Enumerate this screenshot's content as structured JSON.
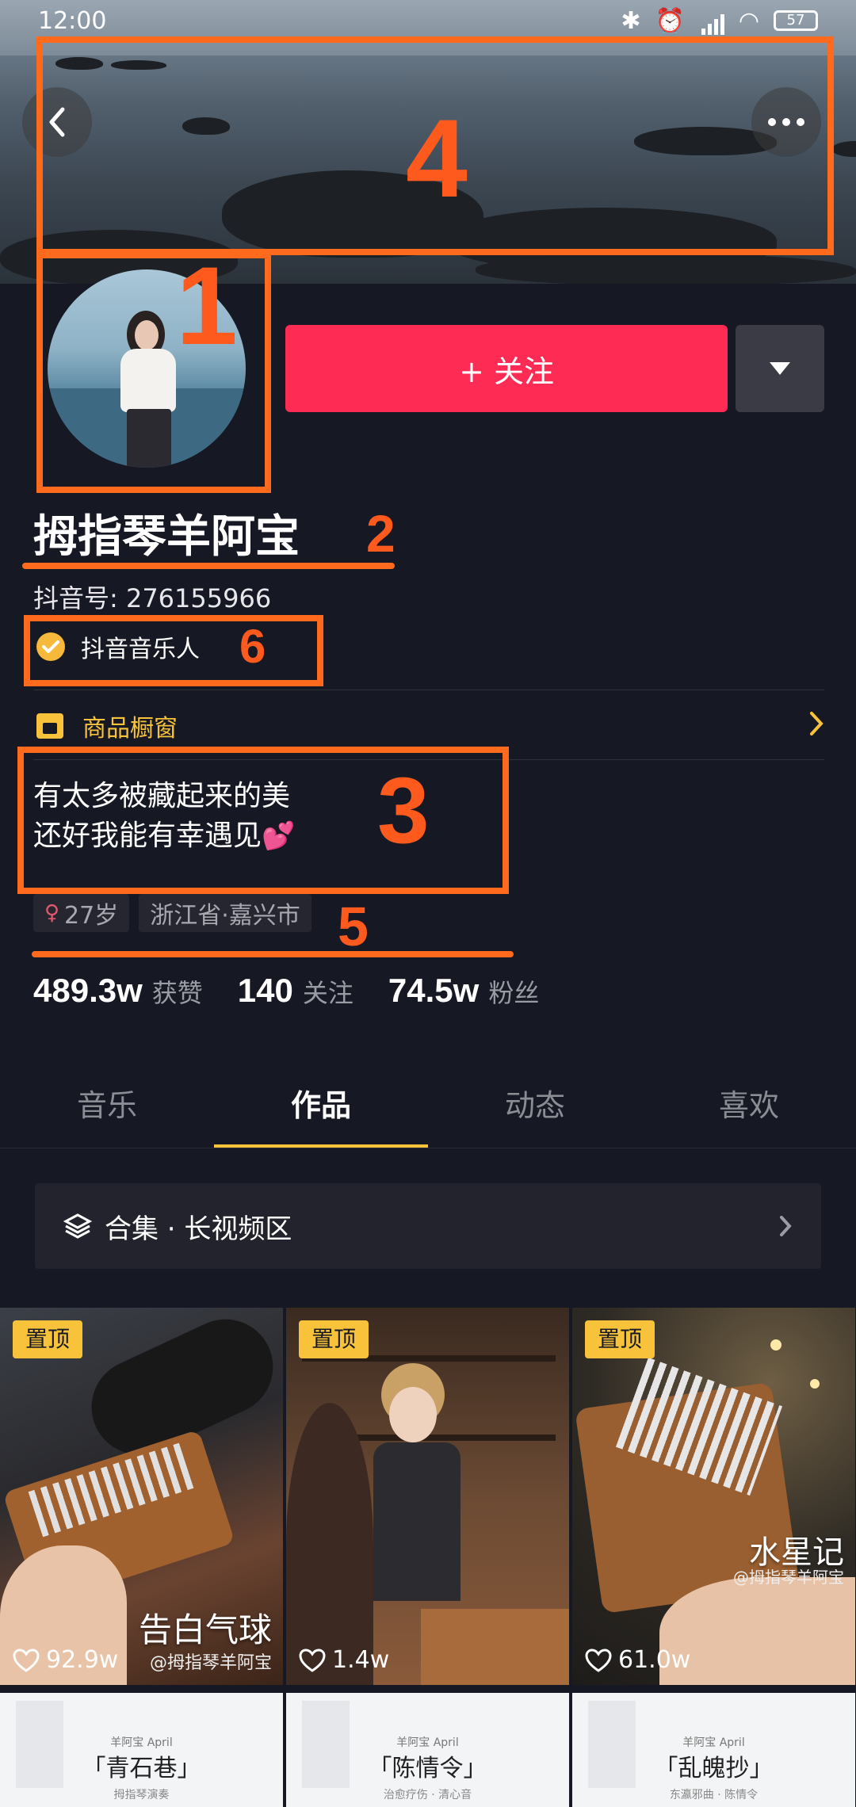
{
  "status_bar": {
    "time": "12:00",
    "battery": "57"
  },
  "header": {
    "back_icon": "back-arrow-icon",
    "more_icon": "more-dots-icon"
  },
  "profile": {
    "name": "拇指琴羊阿宝",
    "douyin_id": "抖音号: 276155966",
    "verification": "抖音音乐人",
    "follow_label": "+ 关注",
    "shop_label": "商品橱窗",
    "bio_line1": "有太多被藏起来的美",
    "bio_line2": "还好我能有幸遇见",
    "tags": [
      "27岁",
      "浙江省·嘉兴市"
    ],
    "stats": [
      {
        "value": "489.3w",
        "label": "获赞"
      },
      {
        "value": "140",
        "label": "关注"
      },
      {
        "value": "74.5w",
        "label": "粉丝"
      }
    ]
  },
  "tabs": [
    "音乐",
    "作品",
    "动态",
    "喜欢"
  ],
  "active_tab": "作品",
  "collection_label": "合集 · 长视频区",
  "videos": [
    {
      "pin": "置顶",
      "likes": "92.9w",
      "title": "告白气球",
      "handle": "@拇指琴羊阿宝"
    },
    {
      "pin": "置顶",
      "likes": "1.4w"
    },
    {
      "pin": "置顶",
      "likes": "61.0w",
      "title": "水星记",
      "handle": "@拇指琴羊阿宝"
    }
  ],
  "videos_row2": [
    {
      "sub": "羊阿宝 April",
      "title": "「青石巷」",
      "foot": "拇指琴演奏"
    },
    {
      "sub": "羊阿宝 April",
      "title": "「陈情令」",
      "foot": "治愈疗伤 · 清心音"
    },
    {
      "sub": "羊阿宝 April",
      "title": "「乱魄抄」",
      "foot": "东瀛邪曲 · 陈情令"
    }
  ],
  "annotations": [
    "1",
    "2",
    "3",
    "4",
    "5",
    "6"
  ],
  "colors": {
    "accent_red": "#fe2c55",
    "accent_yellow": "#f8c33a",
    "annotation_orange": "#ff6a1c",
    "background": "#161823"
  }
}
